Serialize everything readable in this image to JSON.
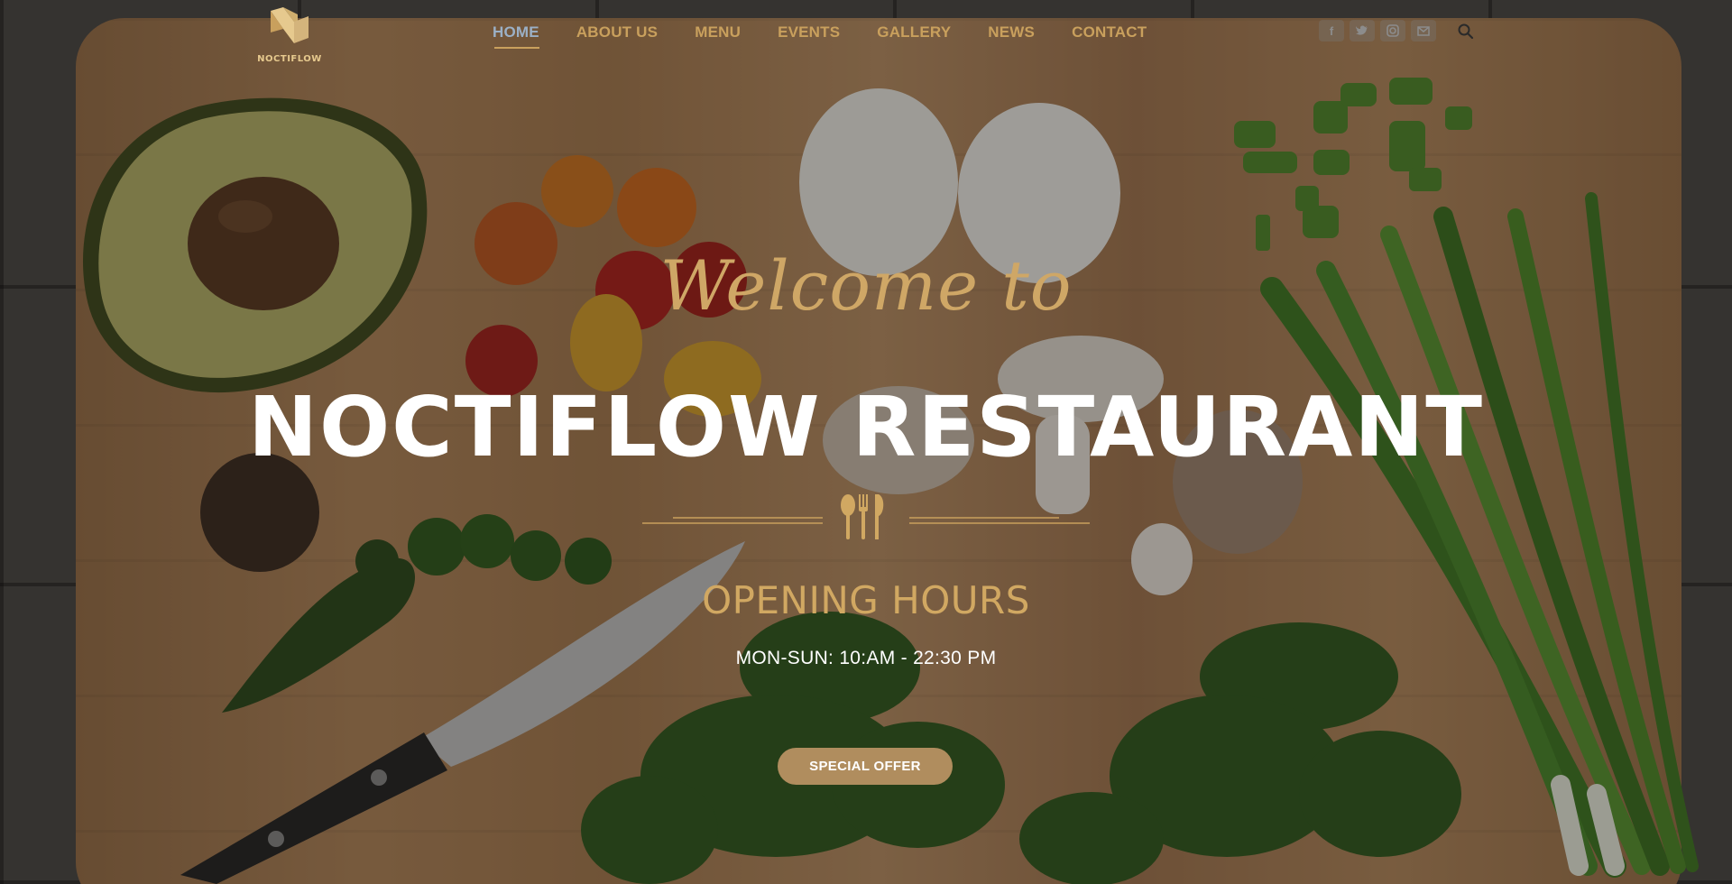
{
  "logo": {
    "text": "NOCTIFLOW"
  },
  "nav": {
    "items": [
      {
        "label": "HOME",
        "active": true
      },
      {
        "label": "ABOUT US"
      },
      {
        "label": "MENU"
      },
      {
        "label": "EVENTS"
      },
      {
        "label": "GALLERY"
      },
      {
        "label": "NEWS"
      },
      {
        "label": "CONTACT"
      }
    ]
  },
  "socials": {
    "facebook": "f",
    "twitter": "twitter-icon",
    "instagram": "instagram-icon",
    "email": "email-icon"
  },
  "hero": {
    "welcome": "Welcome to",
    "title": "NOCTIFLOW RESTAURANT",
    "hours_title": "OPENING HOURS",
    "hours_text": "MON-SUN: 10:AM - 22:30 PM",
    "offer_button": "SPECIAL OFFER"
  },
  "colors": {
    "accent_gold": "#c9a05d",
    "active_nav": "#9bb0c6",
    "button": "#b08d5e"
  }
}
